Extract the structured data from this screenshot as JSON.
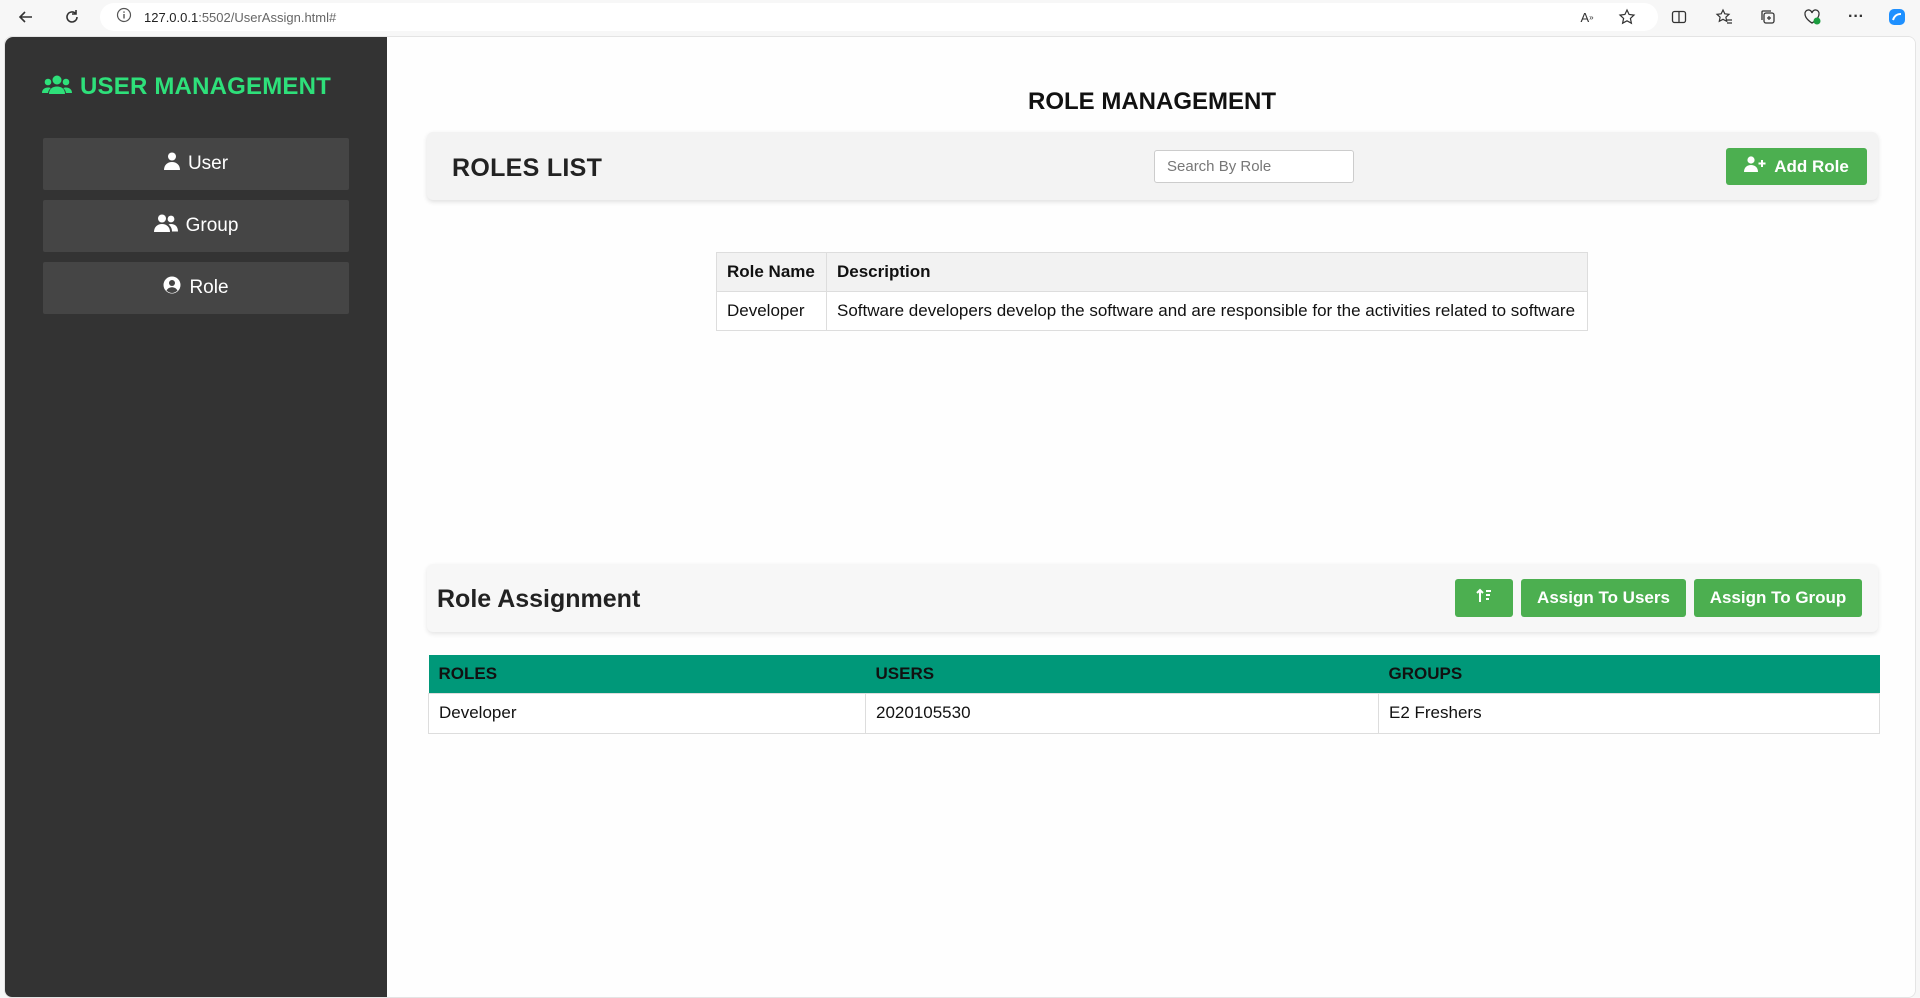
{
  "browser": {
    "url_host": "127.0.0.1",
    "url_rest": ":5502/UserAssign.html#"
  },
  "sidebar": {
    "brand": "USER MANAGEMENT",
    "items": [
      {
        "label": "User",
        "icon": "user-icon"
      },
      {
        "label": "Group",
        "icon": "users-icon"
      },
      {
        "label": "Role",
        "icon": "user-circle-icon"
      }
    ]
  },
  "main": {
    "page_title": "ROLE MANAGEMENT",
    "roles_list": {
      "title": "ROLES LIST",
      "search_placeholder": "Search By Role",
      "add_button": "Add Role",
      "columns": [
        "Role Name",
        "Description"
      ],
      "rows": [
        {
          "name": "Developer",
          "description": "Software developers develop the software and are responsible for the activities related to software"
        }
      ]
    },
    "role_assignment": {
      "title": "Role Assignment",
      "sort_icon": "sort-icon",
      "assign_users_button": "Assign To Users",
      "assign_group_button": "Assign To Group",
      "columns": [
        "ROLES",
        "USERS",
        "GROUPS"
      ],
      "rows": [
        {
          "role": "Developer",
          "users": "2020105530",
          "groups": "E2 Freshers"
        }
      ]
    }
  },
  "colors": {
    "sidebar_bg": "#333333",
    "brand_green": "#2ee07a",
    "button_green": "#4caf50",
    "table_header_teal": "#009879"
  }
}
